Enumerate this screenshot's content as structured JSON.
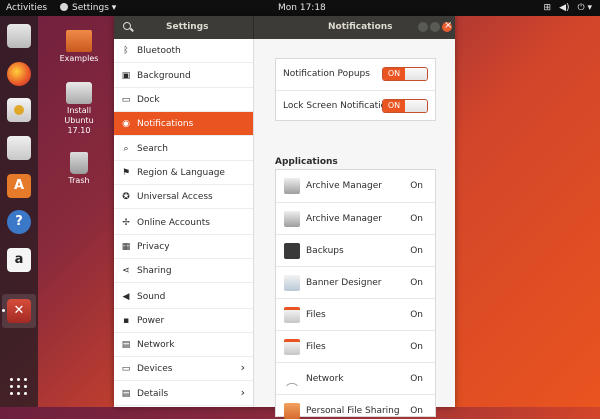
{
  "topbar": {
    "activities": "Activities",
    "app_menu": "Settings",
    "clock": "Mon 17:18",
    "tray_icons": [
      "network-icon",
      "volume-icon",
      "power-icon"
    ]
  },
  "desktop": {
    "icons": [
      {
        "label": "Examples",
        "icon": "folder-icon"
      },
      {
        "label": "Install\nUbuntu\n17.10",
        "icon": "installer-icon"
      },
      {
        "label": "Trash",
        "icon": "trash-icon"
      }
    ]
  },
  "dock": {
    "items": [
      "files-icon",
      "firefox-icon",
      "rhythmbox-icon",
      "writer-icon",
      "software-icon",
      "help-icon",
      "amazon-icon",
      "settings-icon"
    ],
    "apps_grid": "show-applications-icon"
  },
  "window": {
    "left_title": "Settings",
    "title": "Notifications"
  },
  "sidebar": {
    "items": [
      {
        "label": "Bluetooth",
        "icon": "bluetooth-icon",
        "glyph": "ᛒ"
      },
      {
        "label": "Background",
        "icon": "background-icon",
        "glyph": "▣"
      },
      {
        "label": "Dock",
        "icon": "dock-icon",
        "glyph": "▭"
      },
      {
        "label": "Notifications",
        "icon": "notifications-icon",
        "glyph": "◉",
        "selected": true
      },
      {
        "label": "Search",
        "icon": "search-icon",
        "glyph": "⌕"
      },
      {
        "label": "Region & Language",
        "icon": "region-icon",
        "glyph": "⚑"
      },
      {
        "label": "Universal Access",
        "icon": "universal-access-icon",
        "glyph": "✪"
      },
      {
        "label": "Online Accounts",
        "icon": "online-accounts-icon",
        "glyph": "✢"
      },
      {
        "label": "Privacy",
        "icon": "privacy-icon",
        "glyph": "▦"
      },
      {
        "label": "Sharing",
        "icon": "sharing-icon",
        "glyph": "⋖"
      },
      {
        "label": "Sound",
        "icon": "sound-icon",
        "glyph": "◀"
      },
      {
        "label": "Power",
        "icon": "power-icon",
        "glyph": "▪"
      },
      {
        "label": "Network",
        "icon": "network-icon",
        "glyph": "▤"
      },
      {
        "label": "Devices",
        "icon": "devices-icon",
        "glyph": "▭",
        "arrow": "›"
      },
      {
        "label": "Details",
        "icon": "details-icon",
        "glyph": "▤",
        "arrow": "›"
      }
    ]
  },
  "notifications": {
    "popups_label": "Notification Popups",
    "popups_state": "ON",
    "lock_label": "Lock Screen Notifications",
    "lock_state": "ON",
    "applications_title": "Applications",
    "apps": [
      {
        "name": "Archive Manager",
        "state": "On",
        "icon": "archive-manager-icon"
      },
      {
        "name": "Archive Manager",
        "state": "On",
        "icon": "archive-manager-icon"
      },
      {
        "name": "Backups",
        "state": "On",
        "icon": "backups-icon"
      },
      {
        "name": "Banner Designer",
        "state": "On",
        "icon": "banner-designer-icon"
      },
      {
        "name": "Files",
        "state": "On",
        "icon": "files-icon"
      },
      {
        "name": "Files",
        "state": "On",
        "icon": "files-icon"
      },
      {
        "name": "Network",
        "state": "On",
        "icon": "network-icon"
      },
      {
        "name": "Personal File Sharing",
        "state": "On",
        "icon": "file-sharing-icon"
      }
    ]
  }
}
